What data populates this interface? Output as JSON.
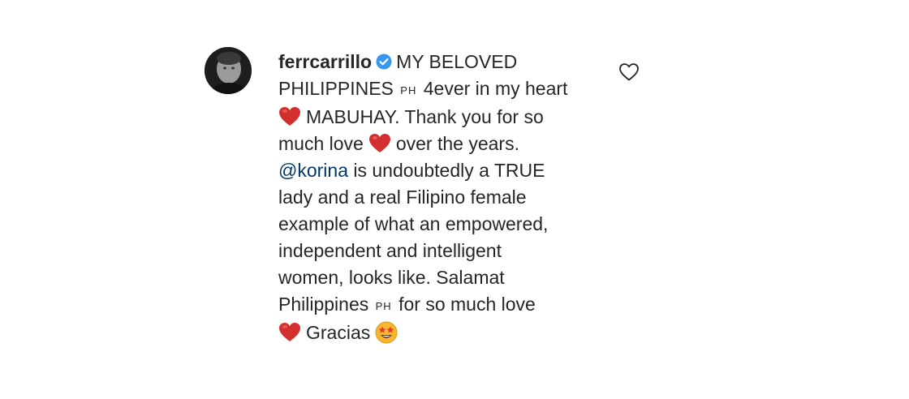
{
  "comment": {
    "username": "ferrcarrillo",
    "verified": true,
    "lines": [
      {
        "text": "MY BELOVED"
      },
      {
        "text_a": "PHILIPPINES",
        "flag": "PH",
        "text_b": "4ever in my heart"
      },
      {
        "text": "MABUHAY. Thank you for so"
      },
      {
        "text_a": "much love",
        "text_b": "over the years."
      },
      {
        "mention": "@korina",
        "text": "is undoubtedly a TRUE"
      },
      {
        "text": "lady and a real Filipino female"
      },
      {
        "text": "example of what an empowered,"
      },
      {
        "text": "independent and intelligent"
      },
      {
        "text": "women, looks like. Salamat"
      },
      {
        "text_a": "Philippines",
        "flag": "PH",
        "text_b": "for so much love"
      },
      {
        "text": "Gracias"
      }
    ],
    "icons": {
      "verified": "verified-badge-icon",
      "heart": "red-heart-emoji",
      "star_eyes": "star-struck-emoji",
      "like": "heart-outline-icon"
    },
    "colors": {
      "text": "#262626",
      "mention": "#00376b",
      "verified": "#3897f0",
      "heart": "#d32f2f"
    }
  }
}
